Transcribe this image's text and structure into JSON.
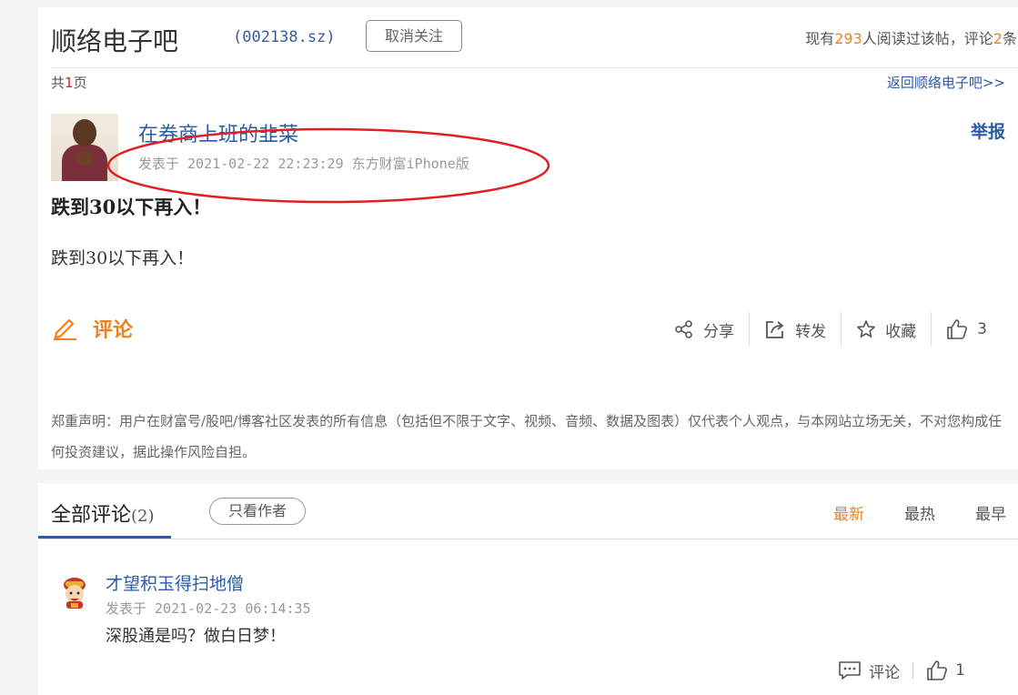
{
  "header": {
    "bar_title": "顺络电子吧",
    "stock_code": "(002138.sz)",
    "unfollow_label": "取消关注",
    "read_prefix": "现有",
    "read_count": "293",
    "read_middle": "人阅读过该帖，评论",
    "comment_count": "2",
    "read_suffix": "条"
  },
  "pager": {
    "prefix": "共",
    "pages": "1",
    "suffix": "页",
    "back_link": "返回顺络电子吧>>"
  },
  "post": {
    "author": "在券商上班的韭菜",
    "meta": "发表于 2021-02-22 22:23:29 东方财富iPhone版",
    "report": "举报",
    "title": "跌到30以下再入！",
    "body": "跌到30以下再入！",
    "comment_label": "评论",
    "actions": {
      "share": "分享",
      "forward": "转发",
      "collect": "收藏",
      "likes": "3"
    },
    "disclaimer": "郑重声明：用户在财富号/股吧/博客社区发表的所有信息（包括但不限于文字、视频、音频、数据及图表）仅代表个人观点，与本网站立场无关，不对您构成任何投资建议，据此操作风险自担。"
  },
  "comments": {
    "header_label": "全部评论",
    "header_count": "(2)",
    "author_only": "只看作者",
    "sort": [
      "最新",
      "最热",
      "最早"
    ],
    "active_sort": "最新",
    "items": [
      {
        "author": "才望积玉得扫地僧",
        "meta": "发表于 2021-02-23 06:14:35",
        "body": "深股通是吗？做白日梦！",
        "reply_label": "评论",
        "likes": "1"
      }
    ]
  },
  "colors": {
    "link": "#2b5aa6",
    "accent": "#f08020",
    "highlight_red": "#e02020"
  },
  "icons": [
    "pencil-icon",
    "share-icon",
    "forward-icon",
    "star-icon",
    "thumbs-up-icon",
    "comment-bubble-icon"
  ]
}
